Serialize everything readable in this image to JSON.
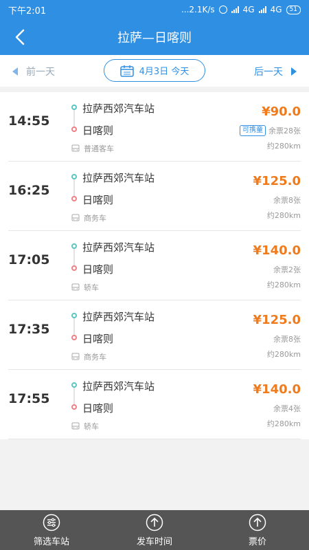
{
  "status": {
    "time": "下午2:01",
    "speed": "...2.1K/s",
    "net1": "4G",
    "net2": "4G",
    "battery": "51"
  },
  "header": {
    "title": "拉萨—日喀则",
    "back_icon": "back-arrow-icon"
  },
  "datebar": {
    "prev_label": "前一天",
    "next_label": "后一天",
    "date_label": "4月3日 今天"
  },
  "trips": [
    {
      "time": "14:55",
      "from": "拉萨西郊汽车站",
      "to": "日喀则",
      "bus_type": "普通客车",
      "price": "¥90.0",
      "badge": "可携童",
      "tickets": "余票28张",
      "distance": "约280km"
    },
    {
      "time": "16:25",
      "from": "拉萨西郊汽车站",
      "to": "日喀则",
      "bus_type": "商务车",
      "price": "¥125.0",
      "badge": "",
      "tickets": "余票8张",
      "distance": "约280km"
    },
    {
      "time": "17:05",
      "from": "拉萨西郊汽车站",
      "to": "日喀则",
      "bus_type": "轿车",
      "price": "¥140.0",
      "badge": "",
      "tickets": "余票2张",
      "distance": "约280km"
    },
    {
      "time": "17:35",
      "from": "拉萨西郊汽车站",
      "to": "日喀则",
      "bus_type": "商务车",
      "price": "¥125.0",
      "badge": "",
      "tickets": "余票8张",
      "distance": "约280km"
    },
    {
      "time": "17:55",
      "from": "拉萨西郊汽车站",
      "to": "日喀则",
      "bus_type": "轿车",
      "price": "¥140.0",
      "badge": "",
      "tickets": "余票4张",
      "distance": "约280km"
    }
  ],
  "tabs": [
    {
      "label": "筛选车站",
      "icon": "filter-icon"
    },
    {
      "label": "发车时间",
      "icon": "sort-up-icon"
    },
    {
      "label": "票价",
      "icon": "sort-up-icon"
    }
  ],
  "colors": {
    "primary": "#2f8fe3",
    "price": "#f07b1d",
    "start_dot": "#59c6c0",
    "end_dot": "#ef7f84"
  }
}
